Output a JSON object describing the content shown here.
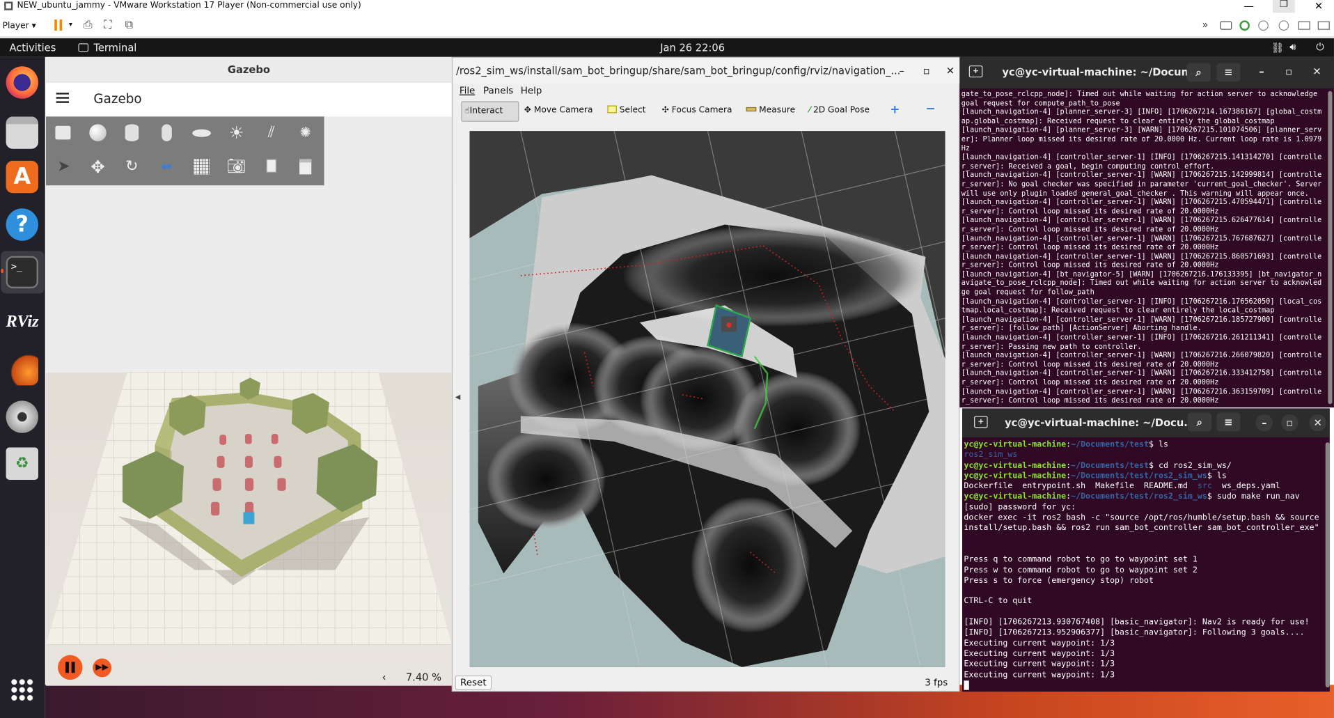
{
  "vmware": {
    "title": "NEW_ubuntu_jammy - VMware Workstation 17 Player (Non-commercial use only)",
    "player_menu": "Player"
  },
  "ubuntu": {
    "activities": "Activities",
    "app_name": "Terminal",
    "clock": "Jan 26  22:06",
    "dock_items": [
      "firefox-icon",
      "files-icon",
      "app-center-icon",
      "help-icon",
      "terminal-icon",
      "rviz-icon",
      "gazebo-icon",
      "dvd-icon",
      "trash-icon",
      "show-apps-icon"
    ],
    "rviz_dock_label": "RViz"
  },
  "gazebo": {
    "window_title": "Gazebo",
    "app_title": "Gazebo",
    "zoom_label": "7.40 %",
    "prev_label": "‹"
  },
  "rviz": {
    "window_title": "/ros2_sim_ws/install/sam_bot_bringup/share/sam_bot_bringup/config/rviz/navigation_...",
    "menus": [
      "File",
      "Panels",
      "Help"
    ],
    "tools": {
      "interact": "Interact",
      "move_camera": "Move Camera",
      "select": "Select",
      "focus_camera": "Focus Camera",
      "measure": "Measure",
      "goal_pose": "2D Goal Pose"
    },
    "reset": "Reset",
    "fps": "3 fps"
  },
  "terminal_top": {
    "title": "yc@yc-virtual-machine: ~/Docum...",
    "log": "gate_to_pose_rclcpp_node]: Timed out while waiting for action server to acknowledge goal request for compute_path_to_pose\n[launch_navigation-4] [planner_server-3] [INFO] [1706267214.167386167] [global_costmap.global_costmap]: Received request to clear entirely the global_costmap\n[launch_navigation-4] [planner_server-3] [WARN] [1706267215.101074506] [planner_server]: Planner loop missed its desired rate of 20.0000 Hz. Current loop rate is 1.0979 Hz\n[launch_navigation-4] [controller_server-1] [INFO] [1706267215.141314270] [controller_server]: Received a goal, begin computing control effort.\n[launch_navigation-4] [controller_server-1] [WARN] [1706267215.142999814] [controller_server]: No goal checker was specified in parameter 'current_goal_checker'. Server will use only plugin loaded general_goal_checker . This warning will appear once.\n[launch_navigation-4] [controller_server-1] [WARN] [1706267215.470594471] [controller_server]: Control loop missed its desired rate of 20.0000Hz\n[launch_navigation-4] [controller_server-1] [WARN] [1706267215.626477614] [controller_server]: Control loop missed its desired rate of 20.0000Hz\n[launch_navigation-4] [controller_server-1] [WARN] [1706267215.767687627] [controller_server]: Control loop missed its desired rate of 20.0000Hz\n[launch_navigation-4] [controller_server-1] [WARN] [1706267215.860571693] [controller_server]: Control loop missed its desired rate of 20.0000Hz\n[launch_navigation-4] [bt_navigator-5] [WARN] [1706267216.176133395] [bt_navigator_navigate_to_pose_rclcpp_node]: Timed out while waiting for action server to acknowledge goal request for follow_path\n[launch_navigation-4] [controller_server-1] [INFO] [1706267216.176562050] [local_costmap.local_costmap]: Received request to clear entirely the local_costmap\n[launch_navigation-4] [controller_server-1] [WARN] [1706267216.185727900] [controller_server]: [follow_path] [ActionServer] Aborting handle.\n[launch_navigation-4] [controller_server-1] [INFO] [1706267216.261211341] [controller_server]: Passing new path to controller.\n[launch_navigation-4] [controller_server-1] [WARN] [1706267216.266079820] [controller_server]: Control loop missed its desired rate of 20.0000Hz\n[launch_navigation-4] [controller_server-1] [WARN] [1706267216.333412758] [controller_server]: Control loop missed its desired rate of 20.0000Hz\n[launch_navigation-4] [controller_server-1] [WARN] [1706267216.363159709] [controller_server]: Control loop missed its desired rate of 20.0000Hz"
  },
  "terminal_bottom": {
    "title": "yc@yc-virtual-machine: ~/Docu...",
    "prompt_user": "yc@yc-virtual-machine",
    "path1": "~/Documents/test",
    "cmd1": "ls",
    "out1": "ros2_sim_ws",
    "cmd2": "cd ros2_sim_ws/",
    "path2": "~/Documents/test/ros2_sim_ws",
    "cmd3": "ls",
    "out3_a": "Dockerfile  entrypoint.sh  Makefile  README.md  ",
    "out3_src": "src",
    "out3_b": "  ws_deps.yaml",
    "cmd4": "sudo make run_nav",
    "output": "[sudo] password for yc:\ndocker exec -it ros2 bash -c \"source /opt/ros/humble/setup.bash && source install/setup.bash && ros2 run sam_bot_controller sam_bot_controller_exe\"\n\n\nPress q to command robot to go to waypoint set 1\nPress w to command robot to go to waypoint set 2\nPress s to force (emergency stop) robot\n\nCTRL-C to quit\n\n[INFO] [1706267213.930767408] [basic_navigator]: Nav2 is ready for use!\n[INFO] [1706267213.952906377] [basic_navigator]: Following 3 goals....\nExecuting current waypoint: 1/3\nExecuting current waypoint: 1/3\nExecuting current waypoint: 1/3\nExecuting current waypoint: 1/3"
  }
}
